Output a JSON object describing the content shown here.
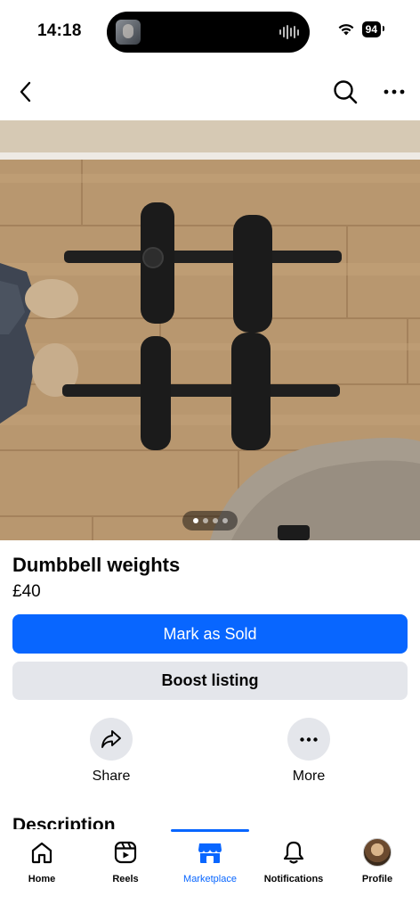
{
  "status_bar": {
    "time": "14:18",
    "battery": "94"
  },
  "listing": {
    "title": "Dumbbell weights",
    "price": "£40",
    "photo_count": 4,
    "current_photo": 1
  },
  "actions": {
    "mark_sold": "Mark as Sold",
    "boost": "Boost listing",
    "share": "Share",
    "more": "More"
  },
  "description_heading": "Description",
  "tabs": [
    {
      "label": "Home",
      "icon": "home-icon"
    },
    {
      "label": "Reels",
      "icon": "reels-icon"
    },
    {
      "label": "Marketplace",
      "icon": "marketplace-icon",
      "active": true
    },
    {
      "label": "Notifications",
      "icon": "bell-icon"
    },
    {
      "label": "Profile",
      "icon": "avatar"
    }
  ],
  "colors": {
    "accent": "#0866ff",
    "secondary_button": "#e4e6eb",
    "text": "#050505"
  }
}
